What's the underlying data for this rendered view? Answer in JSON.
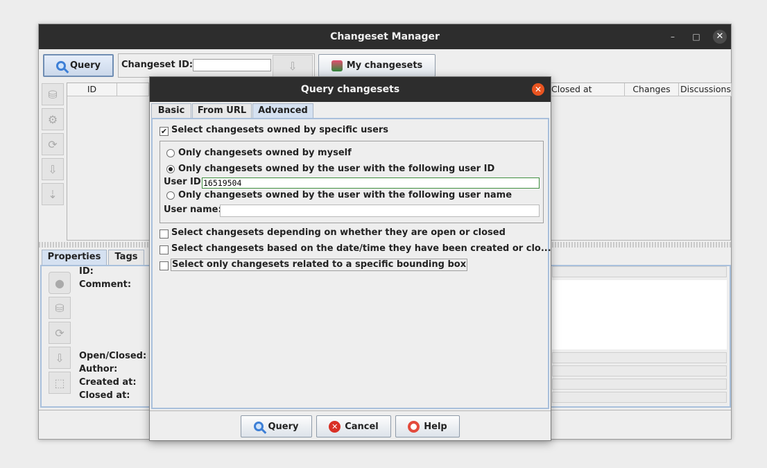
{
  "main_window": {
    "title": "Changeset Manager",
    "minimize_glyph": "–",
    "maximize_glyph": "□",
    "close_glyph": "✕",
    "toolbar": {
      "query_label": "Query",
      "changeset_id_label": "Changeset ID:",
      "changeset_id_value": "",
      "my_changesets_label": "My changesets"
    },
    "table": {
      "headers": [
        "ID",
        "Closed at",
        "Changes",
        "Discussions"
      ]
    },
    "detail_tabs": [
      "Properties",
      "Tags"
    ],
    "properties_labels": {
      "id": "ID:",
      "comment": "Comment:",
      "open_closed": "Open/Closed:",
      "author": "Author:",
      "created_at": "Created at:",
      "closed_at": "Closed at:"
    }
  },
  "dialog": {
    "title": "Query changesets",
    "close_glyph": "✕",
    "tabs": [
      "Basic",
      "From URL",
      "Advanced"
    ],
    "selected_tab": "Advanced",
    "owned_by_users": {
      "label": "Select changesets owned by specific users",
      "checked": true
    },
    "radio_myself": {
      "label": "Only changesets owned by myself",
      "selected": false
    },
    "radio_user_id": {
      "label": "Only changesets owned by the user with the following user ID",
      "selected": true
    },
    "user_id_label": "User ID:",
    "user_id_value": "16519504",
    "radio_user_name": {
      "label": "Only changesets owned by the user with the following user name",
      "selected": false
    },
    "user_name_label": "User name:",
    "user_name_value": "",
    "open_closed": {
      "label": "Select changesets depending on whether they are open or closed",
      "checked": false
    },
    "date_time": {
      "label": "Select changesets based on the date/time they have been created or clo...",
      "checked": false
    },
    "bbox": {
      "label": "Select only changesets related to a specific bounding box",
      "checked": false
    },
    "buttons": {
      "query": "Query",
      "cancel": "Cancel",
      "help": "Help"
    }
  },
  "colors": {
    "title_bar": "#2d2d2d",
    "dialog_close": "#e95420",
    "user_id_border": "#3f8f3f",
    "cancel_icon": "#d93025"
  }
}
